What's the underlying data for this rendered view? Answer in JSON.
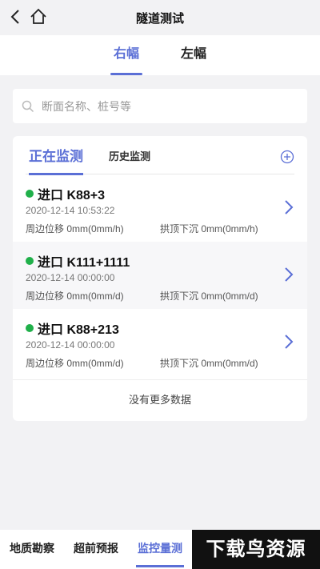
{
  "header": {
    "title": "隧道测试"
  },
  "side_tabs": [
    {
      "label": "右幅",
      "active": true
    },
    {
      "label": "左幅",
      "active": false
    }
  ],
  "search": {
    "placeholder": "断面名称、桩号等"
  },
  "monitor": {
    "tabs": [
      {
        "label": "正在监测",
        "active": true
      },
      {
        "label": "历史监测",
        "active": false
      }
    ],
    "items": [
      {
        "name": "进口 K88+3",
        "time": "2020-12-14 10:53:22",
        "peripheral": "周边位移 0mm(0mm/h)",
        "vault": "拱顶下沉 0mm(0mm/h)",
        "status_color": "#20b04a"
      },
      {
        "name": "进口 K111+1111",
        "time": "2020-12-14 00:00:00",
        "peripheral": "周边位移 0mm(0mm/d)",
        "vault": "拱顶下沉 0mm(0mm/d)",
        "status_color": "#20b04a"
      },
      {
        "name": "进口 K88+213",
        "time": "2020-12-14 00:00:00",
        "peripheral": "周边位移 0mm(0mm/d)",
        "vault": "拱顶下沉 0mm(0mm/d)",
        "status_color": "#20b04a"
      }
    ],
    "footer": "没有更多数据"
  },
  "bottom_tabs": [
    {
      "label": "地质勘察",
      "active": false
    },
    {
      "label": "超前预报",
      "active": false
    },
    {
      "label": "监控量测",
      "active": true
    }
  ],
  "watermark": "下载鸟资源",
  "colors": {
    "accent": "#5b6fd6",
    "status_ok": "#20b04a",
    "background": "#f2f2f4"
  }
}
